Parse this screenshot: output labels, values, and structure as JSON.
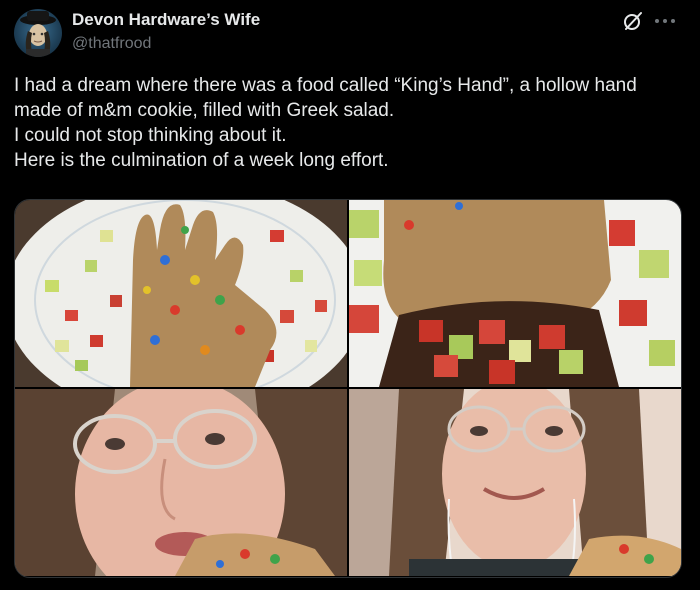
{
  "author": {
    "display_name": "Devon Hardware’s Wife",
    "handle": "@thatfrood",
    "avatar_icon": "avatar-photo"
  },
  "actions": {
    "grok_icon": "grok-icon",
    "more_icon": "more-dots-icon"
  },
  "tweet": {
    "lines": [
      "I had a dream where there was a food called “King’s Hand”, a hollow hand made of m&m cookie, filled with Greek salad.",
      "I could not stop thinking about it.",
      "Here is the culmination of a week long effort."
    ]
  },
  "media": [
    {
      "name": "photo-cookie-hand-plate"
    },
    {
      "name": "photo-cookie-hand-cut-open"
    },
    {
      "name": "photo-person-biting-hand"
    },
    {
      "name": "photo-person-smiling-eating"
    }
  ],
  "colors": {
    "background": "#000000",
    "text": "#e7e9ea",
    "secondary_text": "#71767b",
    "border": "#2f3336"
  }
}
